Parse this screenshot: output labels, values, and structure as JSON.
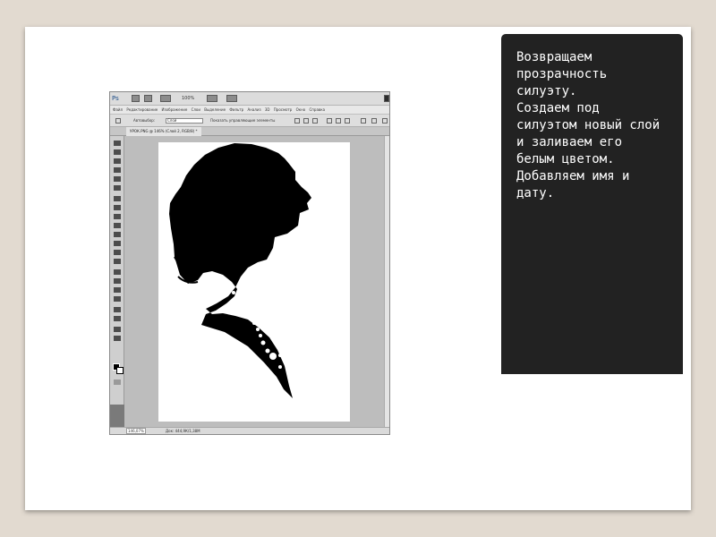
{
  "app": {
    "logo": "Ps",
    "zoom_top": "100%",
    "menu": [
      "Файл",
      "Редактирование",
      "Изображение",
      "Слои",
      "Выделение",
      "Фильтр",
      "Анализ",
      "3D",
      "Просмотр",
      "Окно",
      "Справка"
    ],
    "options": {
      "autoselect_label": "Автовыбор:",
      "autoselect_value": "Слой",
      "transform_label": "Показать управляющие элементы"
    },
    "document_tab": "УРОК.PNG @ 146% (Слой 2, RGB/8) *",
    "status": {
      "zoom": "146,07%",
      "doc": "Док: 444,9К/1,38М"
    }
  },
  "panel": {
    "text": "Возвращаем\nпрозрачность\nсилуэту.\nСоздаем под\nсилуэтом новый слой\nи заливаем его\nбелым цветом.\nДобавляем имя и\nдату."
  },
  "colors": {
    "page_bg": "#e2dad0",
    "slide_bg": "#ffffff",
    "panel_bg": "#222222",
    "panel_text": "#ffffff",
    "silhouette": "#000000"
  },
  "icons": [
    "ps-logo-icon",
    "move-tool-icon",
    "marquee-tool-icon",
    "lasso-tool-icon",
    "crop-tool-icon",
    "brush-tool-icon",
    "type-tool-icon",
    "zoom-tool-icon"
  ]
}
